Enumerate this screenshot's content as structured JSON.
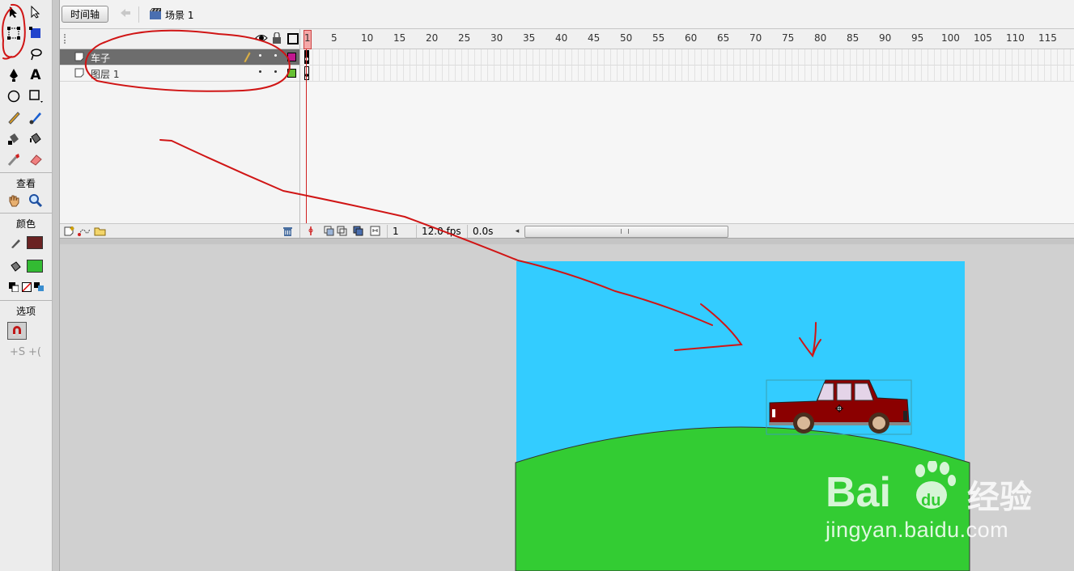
{
  "toolbox": {
    "tools": [
      "selection-tool",
      "subselection-tool",
      "free-transform-tool",
      "gradient-transform-tool",
      "lasso-tool",
      "pen-tool",
      "text-tool",
      "oval-tool",
      "rectangle-tool",
      "pencil-tool",
      "brush-tool",
      "ink-bottle-tool",
      "paint-bucket-tool",
      "eyedropper-tool",
      "eraser-tool"
    ],
    "view_label": "查看",
    "color_label": "颜色",
    "options_label": "选项",
    "stroke_color": "#6a2323",
    "fill_color": "#33bb33"
  },
  "editbar": {
    "timeline_button": "时间轴",
    "scene_label": "场景 1"
  },
  "layers": [
    {
      "name": "车子",
      "selected": true,
      "color": "#c0178f"
    },
    {
      "name": "图层 1",
      "selected": false,
      "color": "#66c033"
    }
  ],
  "ruler": {
    "first": "1",
    "labels": [
      "5",
      "10",
      "15",
      "20",
      "25",
      "30",
      "35",
      "40",
      "45",
      "50",
      "55",
      "60",
      "65",
      "70",
      "75",
      "80",
      "85",
      "90",
      "95",
      "100",
      "105",
      "110",
      "115"
    ]
  },
  "status": {
    "current_frame": "1",
    "fps": "12.0 fps",
    "time": "0.0s"
  },
  "stage": {
    "sky_color": "#33ccff",
    "grass_color": "#33cc33",
    "car_body_color": "#8b0000"
  },
  "watermark": {
    "brand": "Bai du 经验",
    "url": "jingyan.baidu.com"
  }
}
